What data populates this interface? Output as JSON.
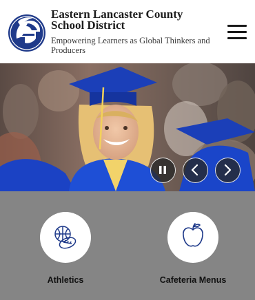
{
  "header": {
    "title": "Eastern Lancaster County School District",
    "tagline": "Empowering Learners as Global Thinkers and Producers",
    "logo_icon": "spartan-helmet-logo",
    "menu_icon": "hamburger-menu-icon"
  },
  "hero": {
    "image": "graduate-in-blue-cap-and-gown-photo",
    "controls": [
      "pause-icon",
      "chevron-left-icon",
      "chevron-right-icon"
    ]
  },
  "quick_links": [
    {
      "label": "Athletics",
      "icon": "sports-balls-icon"
    },
    {
      "label": "Cafeteria Menus",
      "icon": "apple-icon"
    }
  ],
  "colors": {
    "brand_blue": "#1f3a8a",
    "quick_links_background": "#858585",
    "gown_blue": "#1e4fd6"
  }
}
